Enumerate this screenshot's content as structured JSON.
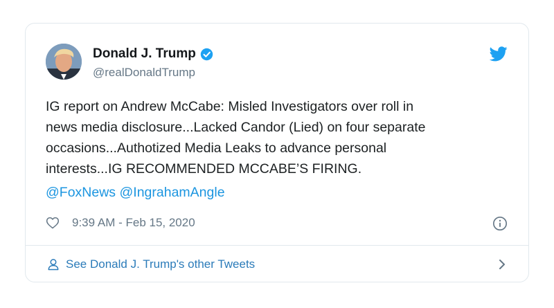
{
  "tweet": {
    "author_name": "Donald J. Trump",
    "author_handle": "@realDonaldTrump",
    "text_lines": [
      "IG report on Andrew McCabe: Misled Investigators over roll in",
      "news media disclosure...Lacked Candor (Lied) on four separate",
      "occasions...Authotized Media Leaks to advance personal",
      "interests...IG RECOMMENDED MCCABE’S FIRING."
    ],
    "mentions": [
      "@FoxNews",
      "@IngrahamAngle"
    ],
    "timestamp": "9:39 AM - Feb 15, 2020"
  },
  "footer": {
    "label": "See Donald J. Trump's other Tweets"
  },
  "icons": {
    "verified": "verified-badge-icon",
    "brand": "twitter-bird-icon",
    "like": "heart-icon",
    "info": "info-icon",
    "profile": "person-icon",
    "navigate": "chevron-right-icon"
  },
  "colors": {
    "twitter_blue": "#1da1f2",
    "link": "#1b95e0",
    "secondary_text": "#657786",
    "footer_link": "#2b7bb9",
    "border": "#e1e8ed"
  }
}
